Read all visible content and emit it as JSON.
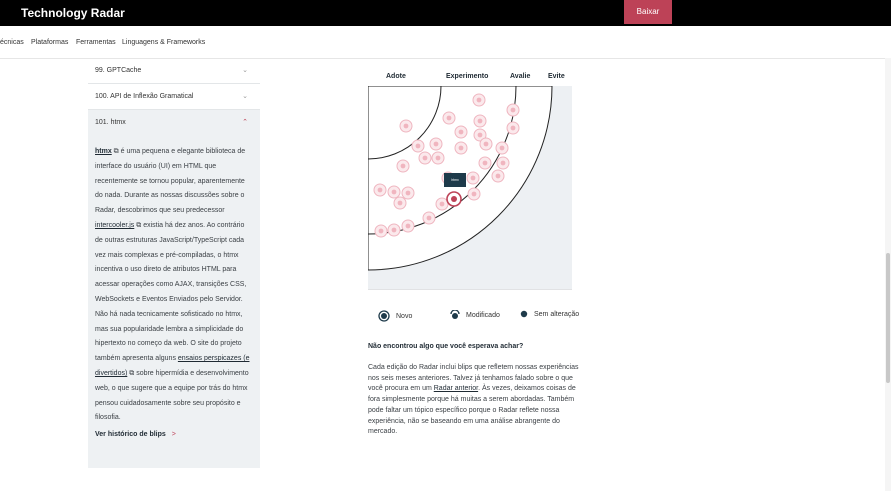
{
  "header": {
    "brand": "Technology Radar",
    "download_label": "Baixar"
  },
  "nav": {
    "items": [
      "écnicas",
      "Plataformas",
      "Ferramentas",
      "Linguagens & Frameworks"
    ]
  },
  "accordion": {
    "items": [
      {
        "label": "99. GPTCache",
        "expanded": false
      },
      {
        "label": "100. API de Inflexão Gramatical",
        "expanded": false
      },
      {
        "label": "101. htmx",
        "expanded": true
      }
    ]
  },
  "blip_detail": {
    "link1": "htmx",
    "text1": " é uma pequena e elegante biblioteca de interface do usuário (UI) em HTML que recentemente se tornou popular, aparentemente do nada. Durante as nossas discussões sobre o Radar, descobrimos que seu predecessor ",
    "link2": "intercooler.js",
    "text2": " existia há dez anos. Ao contrário de outras estruturas JavaScript/TypeScript cada vez mais complexas e pré-compiladas, o htmx incentiva o uso direto de atributos HTML para acessar operações como AJAX, transições CSS, WebSockets e Eventos Enviados pelo Servidor. Não há nada tecnicamente sofisticado no htmx, mas sua popularidade lembra a simplicidade do hipertexto no começo da web. O site do projeto também apresenta alguns ",
    "link3": "ensaios perspicazes (e divertidos)",
    "text3": " sobre hipermídia e desenvolvimento web, o que sugere que a equipe por trás do htmx pensou cuidadosamente sobre seu propósito e filosofia.",
    "history_label": "Ver histórico de blips",
    "history_arrow": ">"
  },
  "radar": {
    "rings": [
      "Adote",
      "Experimento",
      "Avalie",
      "Evite"
    ],
    "tooltip": "htmx",
    "colors": {
      "blip": "#bd4257",
      "evite_fill": "#edf0f3",
      "tooltip": "#1e3a4a"
    }
  },
  "legend": {
    "new": "Novo",
    "modified": "Modificado",
    "unchanged": "Sem alteração"
  },
  "info": {
    "title": "Não encontrou algo que você esperava achar?",
    "text1": "Cada edição do Radar inclui blips que refletem nossas experiências nos seis meses anteriores. Talvez já tenhamos falado sobre o que você procura em um ",
    "link": "Radar anterior",
    "text2": ". Às vezes, deixamos coisas de fora simplesmente porque há muitas a serem abordadas. Também pode faltar um tópico específico porque o Radar reflete nossa experiência, não se baseando em uma análise abrangente do mercado."
  }
}
